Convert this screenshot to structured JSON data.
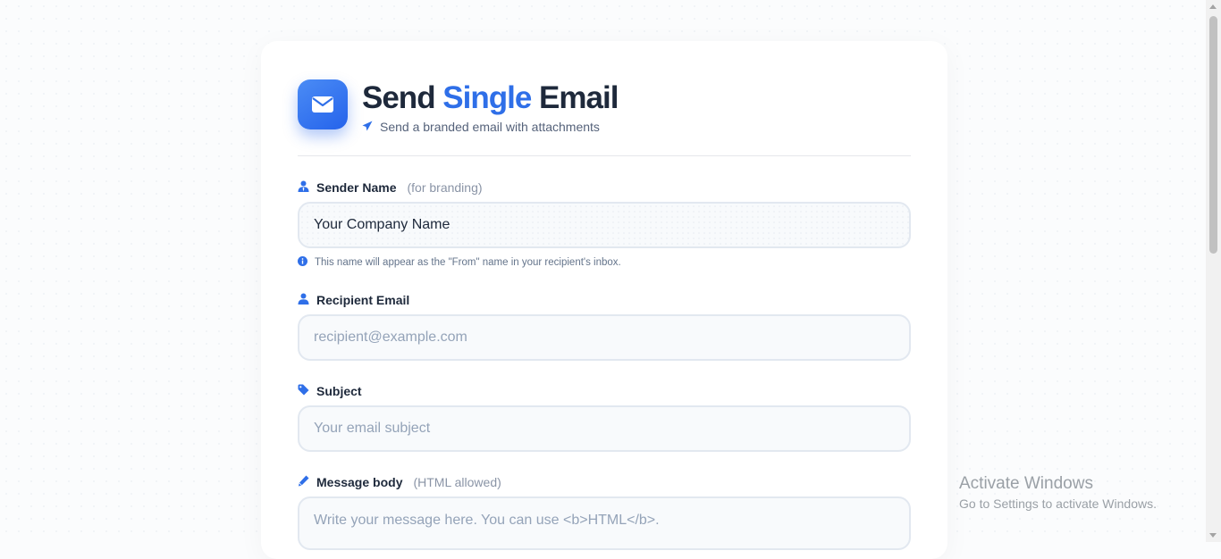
{
  "header": {
    "title_part1": "Send ",
    "title_accent": "Single",
    "title_part2": " Email",
    "subtitle": "Send a branded email with attachments",
    "icon": "envelope-icon",
    "subtitle_icon": "paper-plane-icon"
  },
  "form": {
    "sender": {
      "label": "Sender Name",
      "hint": "(for branding)",
      "value": "Your Company Name",
      "help": "This name will appear as the \"From\" name in your recipient's inbox.",
      "icon": "user-tie-icon"
    },
    "recipient": {
      "label": "Recipient Email",
      "placeholder": "recipient@example.com",
      "icon": "user-icon"
    },
    "subject": {
      "label": "Subject",
      "placeholder": "Your email subject",
      "icon": "tag-icon"
    },
    "message": {
      "label": "Message body",
      "hint": "(HTML allowed)",
      "placeholder": "Write your message here. You can use <b>HTML</b>.",
      "icon": "pen-icon"
    }
  },
  "watermark": {
    "title": "Activate Windows",
    "subtitle": "Go to Settings to activate Windows."
  },
  "colors": {
    "accent": "#2f6fe8",
    "text": "#1e293b",
    "muted": "#8a94a6"
  }
}
